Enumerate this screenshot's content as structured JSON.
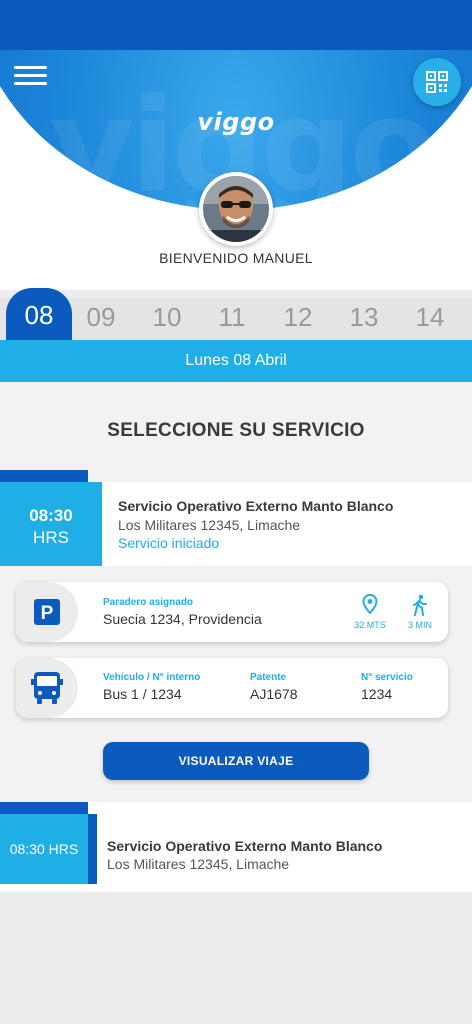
{
  "app": {
    "logo_text": "viggo",
    "watermark_text": "viggo"
  },
  "header": {
    "welcome_text": "BIENVENIDO MANUEL"
  },
  "dates": {
    "active": "08",
    "others": [
      "09",
      "10",
      "11",
      "12",
      "13",
      "14"
    ],
    "day_label": "Lunes 08 Abril"
  },
  "section": {
    "title": "SELECCIONE SU SERVICIO"
  },
  "service1": {
    "time": "08:30",
    "time_unit": "HRS",
    "title": "Servicio Operativo Externo Manto Blanco",
    "address": "Los Militares 12345, Limache",
    "status": "Servicio iniciado"
  },
  "stop_card": {
    "label": "Paradero asignado",
    "value": "Suecia 1234, Providencia",
    "distance": "32 MTS",
    "walk_time": "3 MIN"
  },
  "vehicle_card": {
    "vehicle_label": "Vehiculo / N° interno",
    "vehicle_value": "Bus 1  / 1234",
    "plate_label": "Patente",
    "plate_value": "AJ1678",
    "service_label": "N° servicio",
    "service_value": "1234"
  },
  "actions": {
    "view_trip": "VISUALIZAR VIAJE"
  },
  "service2": {
    "time": "08:30 HRS",
    "title": "Servicio Operativo Externo Manto Blanco",
    "address": "Los Militares 12345, Limache"
  },
  "icons": {
    "menu": "menu-icon",
    "qr": "qr-code-icon",
    "parking": "parking-icon",
    "location": "location-pin-icon",
    "walk": "walking-icon",
    "bus": "bus-icon"
  },
  "colors": {
    "primary": "#0a5bbd",
    "accent": "#1faee6",
    "background": "#ececec"
  }
}
